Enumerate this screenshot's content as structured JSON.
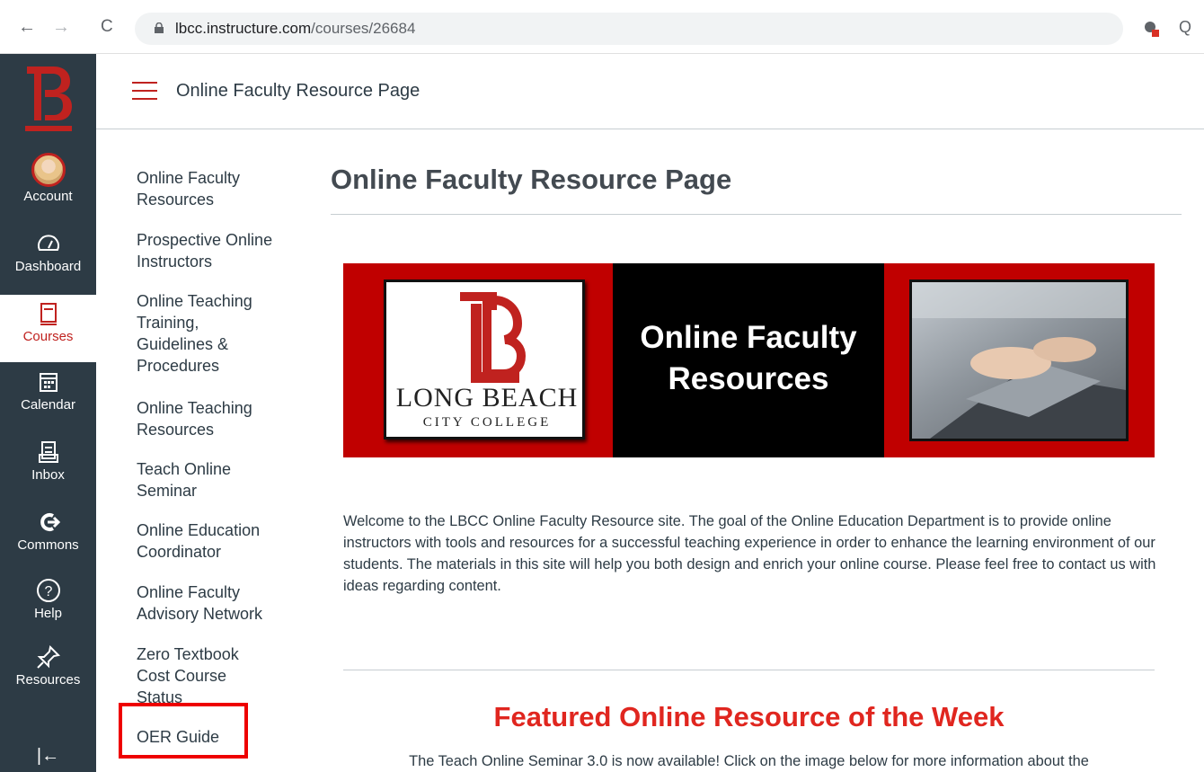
{
  "browser": {
    "back_icon": "←",
    "forward_icon": "→",
    "reload_icon": "C",
    "url_domain": "lbcc.instructure.com",
    "url_path": "/courses/26684",
    "zoom_icon": "Q"
  },
  "global_nav": {
    "logo": "B",
    "items": [
      {
        "label": "Account",
        "icon": "avatar"
      },
      {
        "label": "Dashboard",
        "icon": "dashboard-icon"
      },
      {
        "label": "Courses",
        "icon": "courses-icon",
        "active": true
      },
      {
        "label": "Calendar",
        "icon": "calendar-icon"
      },
      {
        "label": "Inbox",
        "icon": "inbox-icon"
      },
      {
        "label": "Commons",
        "icon": "commons-icon"
      },
      {
        "label": "Help",
        "icon": "help-icon"
      },
      {
        "label": "Resources",
        "icon": "resources-icon"
      }
    ],
    "collapse_icon": "|←"
  },
  "course_header": {
    "breadcrumb": "Online Faculty Resource Page"
  },
  "course_nav": {
    "items": [
      "Online Faculty Resources",
      "Prospective Online Instructors",
      "Online Teaching Training, Guidelines & Procedures",
      "Online Teaching Resources",
      "Teach Online Seminar",
      "Online Education Coordinator",
      "Online Faculty Advisory Network",
      "Zero Textbook Cost Course Status",
      "OER Guide"
    ]
  },
  "main": {
    "title": "Online Faculty Resource Page",
    "banner": {
      "title_line1": "Online Faculty",
      "title_line2": "Resources",
      "college_line1": "LONG BEACH",
      "college_line2": "CITY COLLEGE"
    },
    "welcome": " Welcome to the LBCC Online Faculty Resource site. The goal of the Online Education Department is to provide online instructors with tools and resources for a successful teaching experience in order to enhance the learning environment of our students. The materials in this site will help you both design and enrich your online course. Please feel free to contact us with ideas regarding content.",
    "featured_heading": "Featured Online Resource of the Week",
    "seminar_text": "The Teach Online Seminar 3.0 is now available! Click on the image below for more information about the"
  },
  "colors": {
    "nav_bg": "#2d3b45",
    "brand_red": "#c0221f",
    "highlight_box": "#ee0000"
  }
}
